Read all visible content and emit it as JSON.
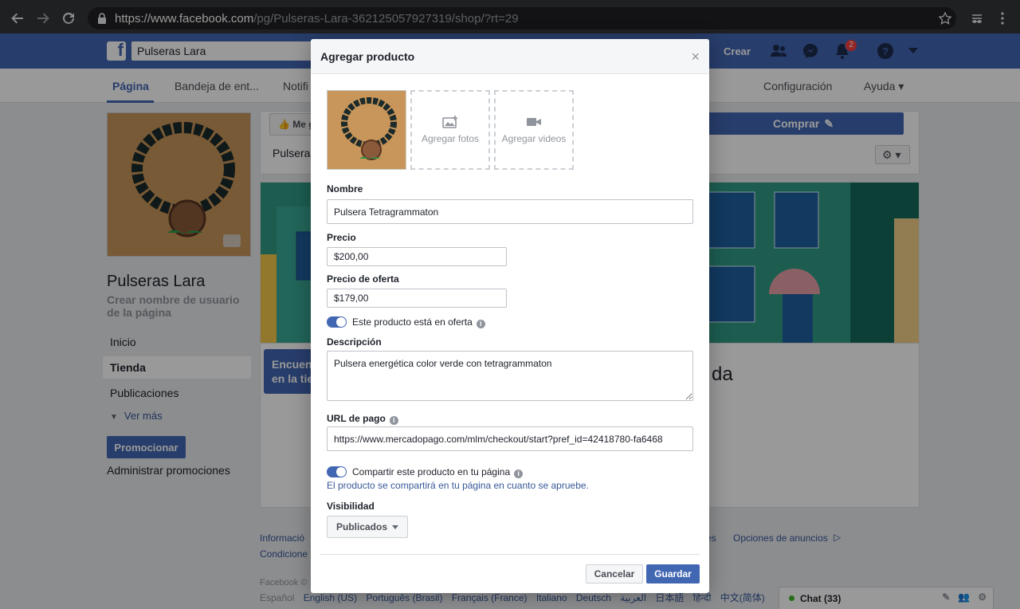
{
  "browser": {
    "url_host": "https://www.facebook.com",
    "url_path": "/pg/Pulseras-Lara-362125057927319/shop/?rt=29"
  },
  "fb_header": {
    "search_value": "Pulseras Lara",
    "create_label": "Crear",
    "notification_count": "2"
  },
  "page_nav": {
    "tabs": [
      "Página",
      "Bandeja de ent...",
      "Notifi"
    ],
    "settings_label": "Configuración",
    "help_label": "Ayuda ▾"
  },
  "left_column": {
    "page_name": "Pulseras Lara",
    "username_prompt": "Crear nombre de usuario de la página",
    "nav_items": [
      "Inicio",
      "Tienda",
      "Publicaciones"
    ],
    "see_more": "Ver más",
    "promote_button": "Promocionar",
    "manage_promotions": "Administrar promociones"
  },
  "behind": {
    "like_label": "Me g",
    "buy_button": "Comprar",
    "page_tab_fragment": "Pulsera",
    "tooltip_text_1": "Encuent",
    "tooltip_text_2": "en la tie",
    "shop_heading_fragment": "da"
  },
  "footer": {
    "link_1": "Informació",
    "link_2": "Condicione",
    "link_3": "es",
    "link_4": "Opciones de anuncios",
    "copyright": "Facebook ©",
    "current_lang": "Español",
    "languages": [
      "English (US)",
      "Português (Brasil)",
      "Français (France)",
      "Italiano",
      "Deutsch",
      "العربية",
      "日本語",
      "हिन्दी",
      "中文(简体)"
    ]
  },
  "chat": {
    "label": "Chat (33)"
  },
  "modal": {
    "title": "Agregar producto",
    "close": "×",
    "add_photos": "Agregar fotos",
    "add_videos": "Agregar videos",
    "name_label": "Nombre",
    "name_value": "Pulsera Tetragrammaton",
    "price_label": "Precio",
    "price_value": "$200,00",
    "sale_price_label": "Precio de oferta",
    "sale_price_value": "$179,00",
    "on_sale_toggle_label": "Este producto está en oferta",
    "description_label": "Descripción",
    "description_value": "Pulsera energética color verde con tetragrammaton",
    "payment_url_label": "URL de pago",
    "payment_url_value": "https://www.mercadopago.com/mlm/checkout/start?pref_id=42418780-fa6468",
    "share_toggle_label": "Compartir este producto en tu página",
    "share_note": "El producto se compartirá en tu página en cuanto se apruebe.",
    "visibility_label": "Visibilidad",
    "visibility_value": "Publicados",
    "cancel_label": "Cancelar",
    "save_label": "Guardar"
  },
  "colors": {
    "fb_blue": "#4267b2",
    "link_blue": "#385898",
    "badge_red": "#fa3e3e"
  }
}
